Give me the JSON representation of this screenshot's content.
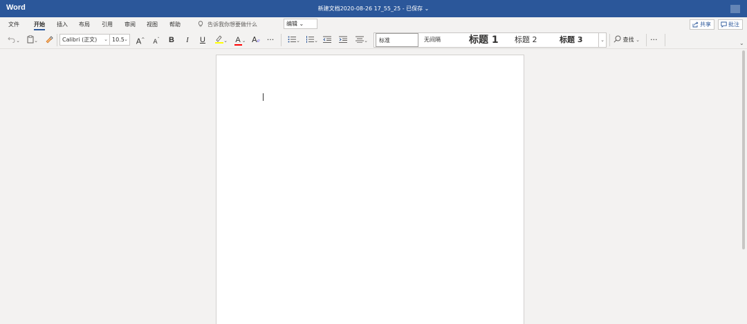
{
  "titlebar": {
    "app_name": "Word",
    "doc_title": "新建文档2020-08-26 17_55_25  -  已保存 ⌄"
  },
  "menu": {
    "tabs": [
      "文件",
      "开始",
      "插入",
      "布局",
      "引用",
      "审阅",
      "视图",
      "帮助"
    ],
    "active_tab": "开始",
    "tell_me": "告诉我你想要做什么",
    "mode_button": "编辑 ⌄",
    "share": "共享",
    "comment": "批注"
  },
  "ribbon": {
    "font_name": "Calibri (正文)",
    "font_size": "10.5",
    "grow_font": "A",
    "shrink_font": "A",
    "bold": "B",
    "italic": "I",
    "underline": "U",
    "highlight_color": "#ffff00",
    "font_color": "#ff0000",
    "font_color_letter": "A",
    "clear_format": "A",
    "more": "···",
    "find": "查找",
    "more2": "···"
  },
  "styles": {
    "items": [
      "标准",
      "无间隔",
      "标题 1",
      "标题 2",
      "标题 3"
    ],
    "selected": "标准"
  },
  "colors": {
    "brand": "#2b579a",
    "ribbon_bg": "#f3f2f1",
    "page_bg": "#ffffff"
  }
}
